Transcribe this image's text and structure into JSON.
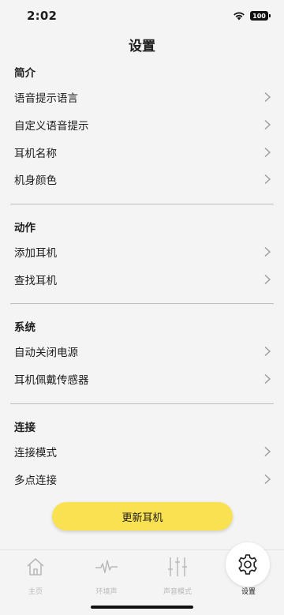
{
  "status": {
    "time": "2:02",
    "battery": "100"
  },
  "page": {
    "title": "设置"
  },
  "sections": [
    {
      "header": "简介",
      "items": [
        "语音提示语言",
        "自定义语音提示",
        "耳机名称",
        "机身颜色"
      ]
    },
    {
      "header": "动作",
      "items": [
        "添加耳机",
        "查找耳机"
      ]
    },
    {
      "header": "系统",
      "items": [
        "自动关闭电源",
        "耳机佩戴传感器"
      ]
    },
    {
      "header": "连接",
      "items": [
        "连接模式",
        "多点连接"
      ]
    }
  ],
  "update_button": "更新耳机",
  "tabs": [
    {
      "label": "主页",
      "icon": "home-icon"
    },
    {
      "label": "环境声",
      "icon": "ambient-sound-icon"
    },
    {
      "label": "声音模式",
      "icon": "equalizer-icon"
    },
    {
      "label": "设置",
      "icon": "gear-icon"
    }
  ],
  "colors": {
    "accent": "#f9e152",
    "background": "#f4f4f4",
    "inactive": "#b9b9b9"
  }
}
